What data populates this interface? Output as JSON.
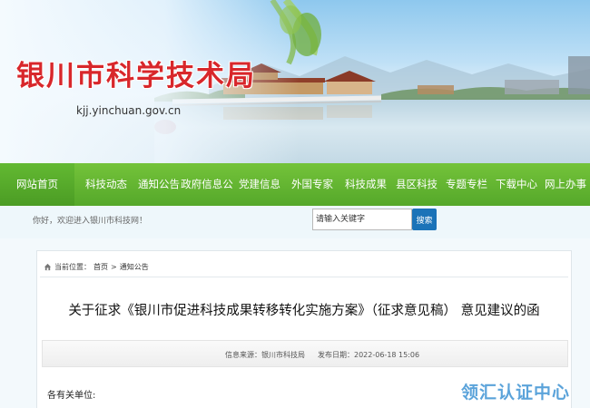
{
  "banner": {
    "site_title": "银川市科学技术局",
    "site_url": "kjj.yinchuan.gov.cn"
  },
  "nav": {
    "items": [
      {
        "label": "网站首页"
      },
      {
        "label": "科技动态"
      },
      {
        "label": "通知公告"
      },
      {
        "label": "政府信息公开"
      },
      {
        "label": "党建信息"
      },
      {
        "label": "外国专家"
      },
      {
        "label": "科技成果"
      },
      {
        "label": "县区科技"
      },
      {
        "label": "专题专栏"
      },
      {
        "label": "下载中心"
      },
      {
        "label": "网上办事"
      }
    ]
  },
  "toolbar": {
    "welcome": "你好，欢迎进入银川市科技网！",
    "search_placeholder": "请输入关键字",
    "search_button": "搜索"
  },
  "breadcrumb": {
    "prefix": "当前位置：",
    "home": "首页",
    "separator": ">",
    "section": "通知公告"
  },
  "article": {
    "title": "关于征求《银川市促进科技成果转移转化实施方案》（征求意见稿） 意见建议的函",
    "source_label": "信息来源：",
    "source_value": "银川市科技局",
    "date_label": "发布日期：",
    "date_value": "2022-06-18 15:06",
    "salutation": "各有关单位:"
  },
  "watermark": "领汇认证中心",
  "colors": {
    "title_red": "#d8272b",
    "nav_green": "#5aae2d",
    "search_blue": "#1b73b8",
    "watermark_blue": "#4a9ad6"
  }
}
